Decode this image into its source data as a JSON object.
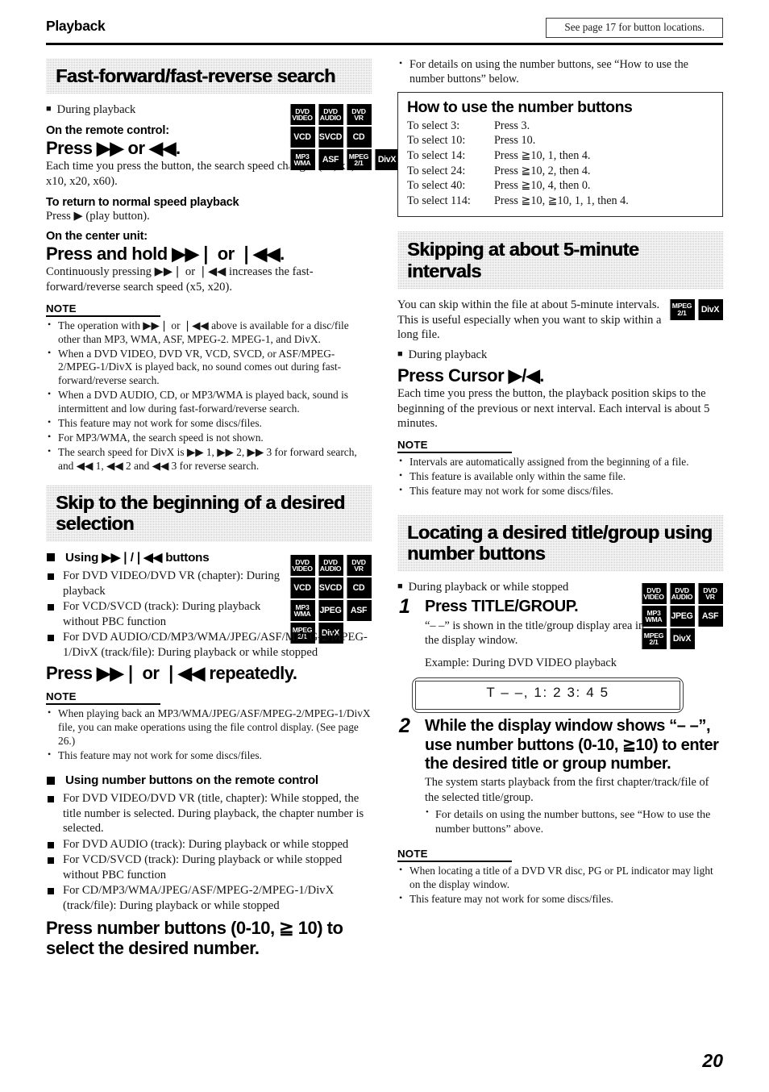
{
  "header": {
    "chapter": "Playback",
    "see_page_note": "See page 17 for button locations."
  },
  "page_number": "20",
  "left_column": {
    "section1": {
      "title": "Fast-forward/fast-reverse search",
      "condition": "During playback",
      "badges": [
        {
          "line1": "DVD",
          "line2": "VIDEO"
        },
        {
          "line1": "DVD",
          "line2": "AUDIO"
        },
        {
          "line1": "DVD",
          "line2": "VR"
        },
        {
          "line1": "VCD",
          "line2": ""
        },
        {
          "line1": "SVCD",
          "line2": ""
        },
        {
          "line1": "CD",
          "line2": ""
        },
        {
          "line1": "MP3",
          "line2": "WMA"
        },
        {
          "line1": "ASF",
          "line2": ""
        },
        {
          "line1": "MPEG",
          "line2": "2/1"
        },
        {
          "line1": "DivX",
          "line2": ""
        }
      ],
      "lead1": "On the remote control:",
      "instruction1": "Press ▶▶ or ◀◀.",
      "body1": "Each time you press the button, the search speed changes (x2, x5, x10, x20, x60).",
      "lead2": "To return to normal speed playback",
      "body2": "Press ▶ (play button).",
      "lead3": "On the center unit:",
      "instruction2": "Press and hold ▶▶❘ or ❘◀◀.",
      "body3": "Continuously pressing ▶▶❘ or ❘◀◀ increases the fast-forward/reverse search speed (x5, x20).",
      "note_label": "NOTE",
      "notes": [
        "The operation with ▶▶❘ or ❘◀◀ above is available for a disc/file other than MP3, WMA, ASF, MPEG-2. MPEG-1, and DivX.",
        "When a DVD VIDEO, DVD VR, VCD, SVCD, or ASF/MPEG-2/MPEG-1/DivX is played back, no sound comes out during fast-forward/reverse search.",
        "When a DVD AUDIO, CD, or MP3/WMA is played back, sound is intermittent and low during fast-forward/reverse search.",
        "This feature may not work for some discs/files.",
        "For MP3/WMA, the search speed is not shown.",
        "The search speed for DivX is ▶▶ 1, ▶▶ 2, ▶▶ 3 for forward search, and ◀◀ 1, ◀◀ 2 and ◀◀ 3 for reverse search."
      ]
    },
    "section2": {
      "title": "Skip to the beginning of a desired selection",
      "badges": [
        {
          "line1": "DVD",
          "line2": "VIDEO"
        },
        {
          "line1": "DVD",
          "line2": "AUDIO"
        },
        {
          "line1": "DVD",
          "line2": "VR"
        },
        {
          "line1": "VCD",
          "line2": ""
        },
        {
          "line1": "SVCD",
          "line2": ""
        },
        {
          "line1": "CD",
          "line2": ""
        },
        {
          "line1": "MP3",
          "line2": "WMA"
        },
        {
          "line1": "JPEG",
          "line2": ""
        },
        {
          "line1": "ASF",
          "line2": ""
        },
        {
          "line1": "MPEG",
          "line2": "2/1"
        },
        {
          "line1": "DivX",
          "line2": ""
        }
      ],
      "subhead1": "Using ▶▶❘/❘◀◀ buttons",
      "items1": [
        "For DVD VIDEO/DVD VR (chapter): During playback",
        "For VCD/SVCD (track): During playback without PBC function",
        "For DVD AUDIO/CD/MP3/WMA/JPEG/ASF/MPEG-2/MPEG-1/DivX (track/file): During playback or while stopped"
      ],
      "instruction1": "Press ▶▶❘ or ❘◀◀ repeatedly.",
      "note_label": "NOTE",
      "notes": [
        "When playing back an MP3/WMA/JPEG/ASF/MPEG-2/MPEG-1/DivX file, you can make operations using the file control display. (See page 26.)",
        "This feature may not work for some discs/files."
      ],
      "subhead2": "Using number buttons on the remote control",
      "items2": [
        "For DVD VIDEO/DVD VR (title, chapter): While stopped, the title number is selected. During playback, the chapter number is selected.",
        "For DVD AUDIO (track): During playback or while stopped",
        "For VCD/SVCD (track): During playback or while stopped without PBC function",
        "For CD/MP3/WMA/JPEG/ASF/MPEG-2/MPEG-1/DivX (track/file): During playback or while stopped"
      ],
      "instruction2": "Press number buttons (0-10, ≧ 10) to select the desired number."
    }
  },
  "right_column": {
    "top_note": "For details on using the number buttons, see “How to use the number buttons” below.",
    "howto_box": {
      "title": "How to use the number buttons",
      "rows": [
        {
          "select": "To select 3:",
          "press": "Press 3."
        },
        {
          "select": "To select 10:",
          "press": "Press 10."
        },
        {
          "select": "To select 14:",
          "press": "Press ≧10, 1, then 4."
        },
        {
          "select": "To select 24:",
          "press": "Press ≧10, 2, then 4."
        },
        {
          "select": "To select 40:",
          "press": "Press ≧10, 4, then 0."
        },
        {
          "select": "To select 114:",
          "press": "Press ≧10, ≧10, 1, 1, then 4."
        }
      ]
    },
    "section3": {
      "title": "Skipping at about 5-minute intervals",
      "badges": [
        {
          "line1": "MPEG",
          "line2": "2/1"
        },
        {
          "line1": "DivX",
          "line2": ""
        }
      ],
      "body1": "You can skip within the file at about 5-minute intervals. This is useful especially when you want to skip within a long file.",
      "condition": "During playback",
      "instruction": "Press Cursor ▶/◀.",
      "body2": "Each time you press the button, the playback position skips to the beginning of the previous or next interval. Each interval is about 5 minutes.",
      "note_label": "NOTE",
      "notes": [
        "Intervals are automatically assigned from the beginning of a file.",
        "This feature is available only within the same file.",
        "This feature may not work for some discs/files."
      ]
    },
    "section4": {
      "title": "Locating a desired title/group using number buttons",
      "badges": [
        {
          "line1": "DVD",
          "line2": "VIDEO"
        },
        {
          "line1": "DVD",
          "line2": "AUDIO"
        },
        {
          "line1": "DVD",
          "line2": "VR"
        },
        {
          "line1": "MP3",
          "line2": "WMA"
        },
        {
          "line1": "JPEG",
          "line2": ""
        },
        {
          "line1": "ASF",
          "line2": ""
        },
        {
          "line1": "MPEG",
          "line2": "2/1"
        },
        {
          "line1": "DivX",
          "line2": ""
        }
      ],
      "condition": "During playback or while stopped",
      "step1": {
        "number": "1",
        "title": "Press TITLE/GROUP.",
        "body": "“– –” is shown in the title/group display area in the display window.",
        "example_label": "Example: During DVD VIDEO playback",
        "display_window_text": "T – –, 1: 2  3: 4  5"
      },
      "step2": {
        "number": "2",
        "title": "While the display window shows “– –”, use number buttons (0-10, ≧10) to enter the desired title or group number.",
        "body": "The system starts playback from the first chapter/track/file of the selected title/group.",
        "sub_bullet": "For details on using the number buttons, see “How to use the number buttons” above."
      },
      "note_label": "NOTE",
      "notes": [
        "When locating a title of a DVD VR disc, PG or PL indicator may light on the display window.",
        "This feature may not work for some discs/files."
      ]
    }
  }
}
